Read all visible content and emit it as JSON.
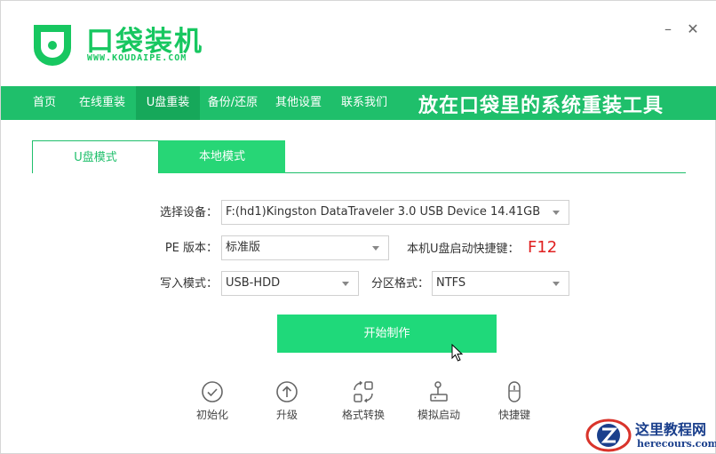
{
  "app": {
    "brand_name": "口袋装机",
    "brand_url": "WWW.KOUDAIPE.COM",
    "minimize": "–",
    "close": "✕"
  },
  "nav": {
    "items": [
      {
        "label": "首页"
      },
      {
        "label": "在线重装"
      },
      {
        "label": "U盘重装",
        "active": true
      },
      {
        "label": "备份/还原"
      },
      {
        "label": "其他设置"
      },
      {
        "label": "联系我们"
      }
    ],
    "slogan": "放在口袋里的系统重装工具"
  },
  "tabs": [
    {
      "label": "U盘模式",
      "active": true
    },
    {
      "label": "本地模式"
    }
  ],
  "form": {
    "device_label": "选择设备：",
    "device_value": "F:(hd1)Kingston DataTraveler 3.0 USB Device 14.41GB",
    "pe_label": "PE 版本：",
    "pe_value": "标准版",
    "hotkey_label": "本机U盘启动快捷键：",
    "hotkey_value": "F12",
    "write_label": "写入模式：",
    "write_value": "USB-HDD",
    "partition_label": "分区格式：",
    "partition_value": "NTFS"
  },
  "start_button": "开始制作",
  "tools": [
    {
      "label": "初始化",
      "icon": "check-circle-icon"
    },
    {
      "label": "升级",
      "icon": "upgrade-arrow-icon"
    },
    {
      "label": "格式转换",
      "icon": "convert-icon"
    },
    {
      "label": "模拟启动",
      "icon": "joystick-icon"
    },
    {
      "label": "快捷键",
      "icon": "mouse-icon"
    }
  ],
  "watermark": {
    "cn": "这里教程网",
    "url": "herecours.com"
  },
  "colors": {
    "brand_green": "#17c760",
    "nav_green": "#1fbf6b",
    "nav_active": "#16a85a",
    "button_green": "#1fd97a",
    "hotkey_red": "#e02020"
  }
}
